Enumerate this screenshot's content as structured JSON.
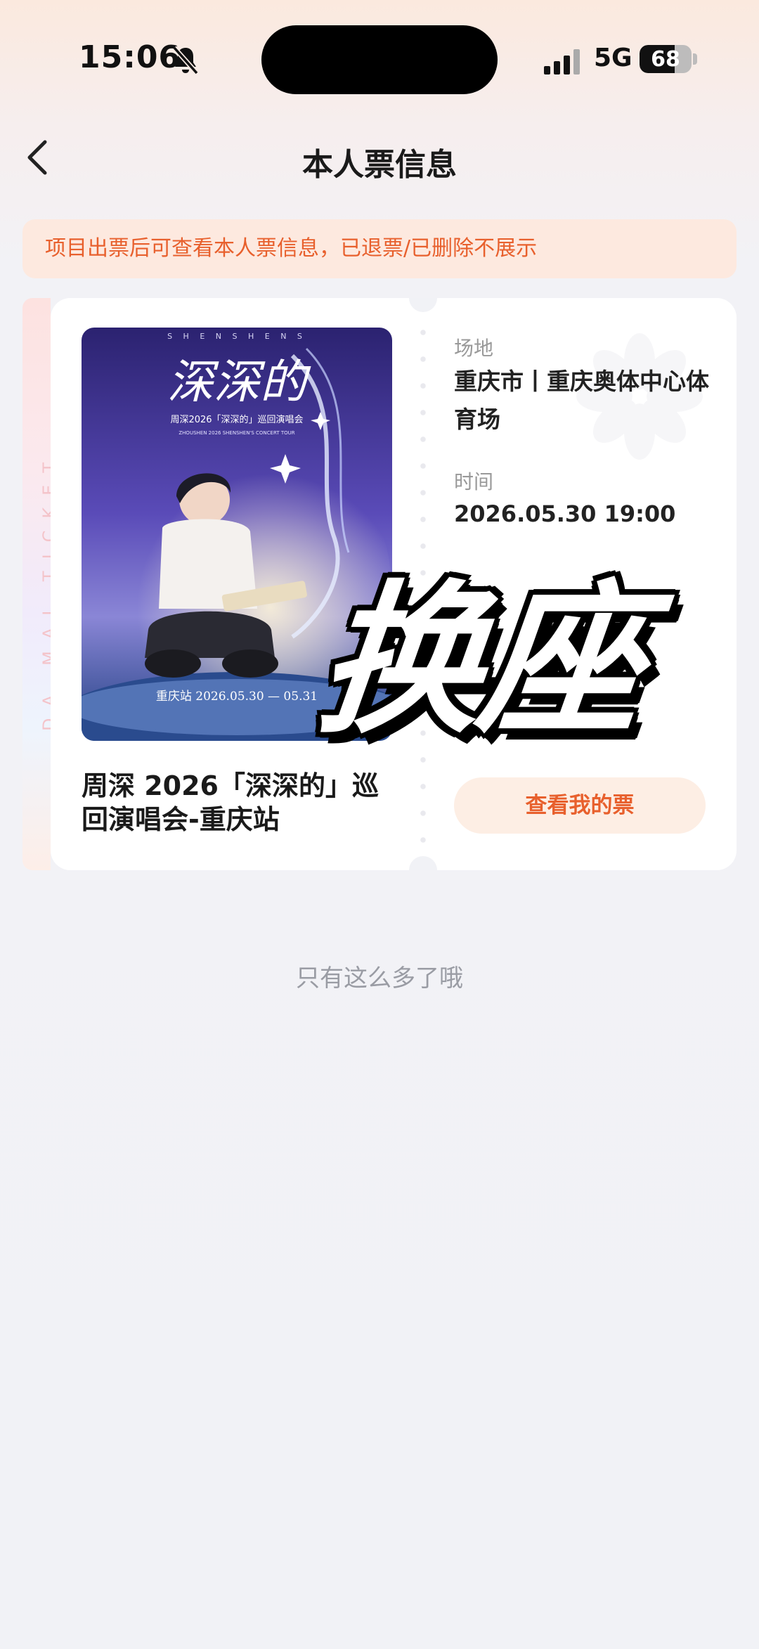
{
  "status_bar": {
    "time": "15:06",
    "network": "5G",
    "battery": "68",
    "battery_level": 0.68,
    "silent_icon": "bell-slash-icon",
    "signal_icon": "signal-bars-icon"
  },
  "nav": {
    "back_icon": "chevron-left-icon",
    "title": "本人票信息"
  },
  "notice": {
    "text": "项目出票后可查看本人票信息，已退票/已删除不展示"
  },
  "ticket": {
    "side_label": "DA MAI TICKET",
    "poster": {
      "brand_line": "S H E N S H E N S",
      "logo_text": "深深的",
      "tour_line": "周深2026「深深的」巡回演唱会",
      "tour_line_en": "ZHOUSHEN 2026 SHENSHEN'S CONCERT TOUR",
      "city_date": "重庆站 2026.05.30 — 05.31"
    },
    "event_title": "周深 2026「深深的」巡回演唱会-重庆站",
    "venue_label": "场地",
    "venue_value": "重庆市丨重庆奥体中心体育场",
    "time_label": "时间",
    "time_value": "2026.05.30 19:00",
    "view_button": "查看我的票"
  },
  "overlay": {
    "sticker_text": "换座"
  },
  "footer": {
    "end_note": "只有这么多了哦"
  },
  "colors": {
    "accent": "#e8602d",
    "notice_bg": "#fde9df",
    "button_bg": "#fdeee4",
    "page_bg": "#f1f2f6"
  }
}
